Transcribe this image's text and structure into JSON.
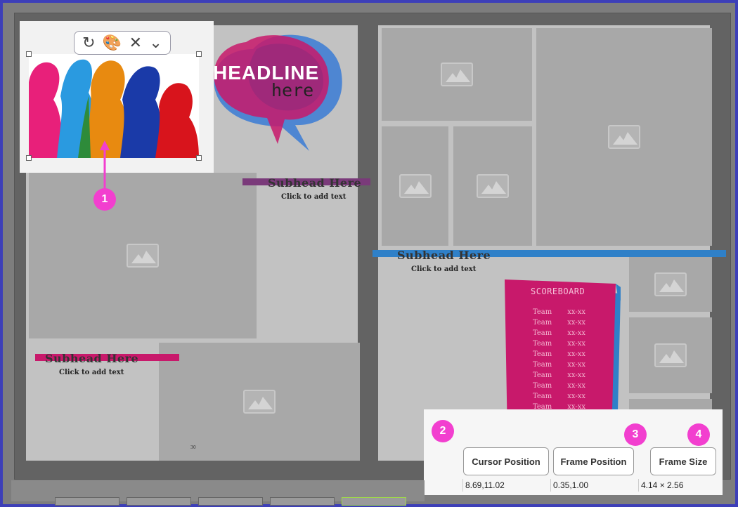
{
  "left_page": {
    "headline_line1": "HEADLINE",
    "headline_line2": "here",
    "subhead_top": "Subhead Here",
    "click_top": "Click to add text",
    "subhead_bottom": "Subhead Here",
    "click_bottom": "Click to add text",
    "page_number": "30"
  },
  "right_page": {
    "subhead": "Subhead Here",
    "click_text": "Click to add text",
    "scoreboard_title": "SCOREBOARD",
    "scoreboard_rows": [
      [
        "Team",
        "xx-xx"
      ],
      [
        "Team",
        "xx-xx"
      ],
      [
        "Team",
        "xx-xx"
      ],
      [
        "Team",
        "xx-xx"
      ],
      [
        "Team",
        "xx-xx"
      ],
      [
        "Team",
        "xx-xx"
      ],
      [
        "Team",
        "xx-xx"
      ],
      [
        "Team",
        "xx-xx"
      ],
      [
        "Team",
        "xx-xx"
      ],
      [
        "Team",
        "xx-xx"
      ],
      [
        "Team",
        "xx-xx"
      ],
      [
        "Team",
        "xx-xx"
      ]
    ]
  },
  "image_toolbar": {
    "icons": [
      "rotate-icon",
      "palette-icon",
      "close-icon",
      "chevron-down-icon"
    ]
  },
  "callouts": [
    "1",
    "2",
    "3",
    "4"
  ],
  "status": {
    "cursor_label": "Cursor Position",
    "cursor_value": "8.69,11.02",
    "frame_pos_label": "Frame Position",
    "frame_pos_value": "0.35,1.00",
    "frame_size_label": "Frame Size",
    "frame_size_value": "4.14 × 2.56"
  },
  "colors": {
    "callout": "#f23fcf",
    "pink": "#c8196b",
    "blue": "#2f80c8",
    "purple": "#6b2a7a"
  }
}
